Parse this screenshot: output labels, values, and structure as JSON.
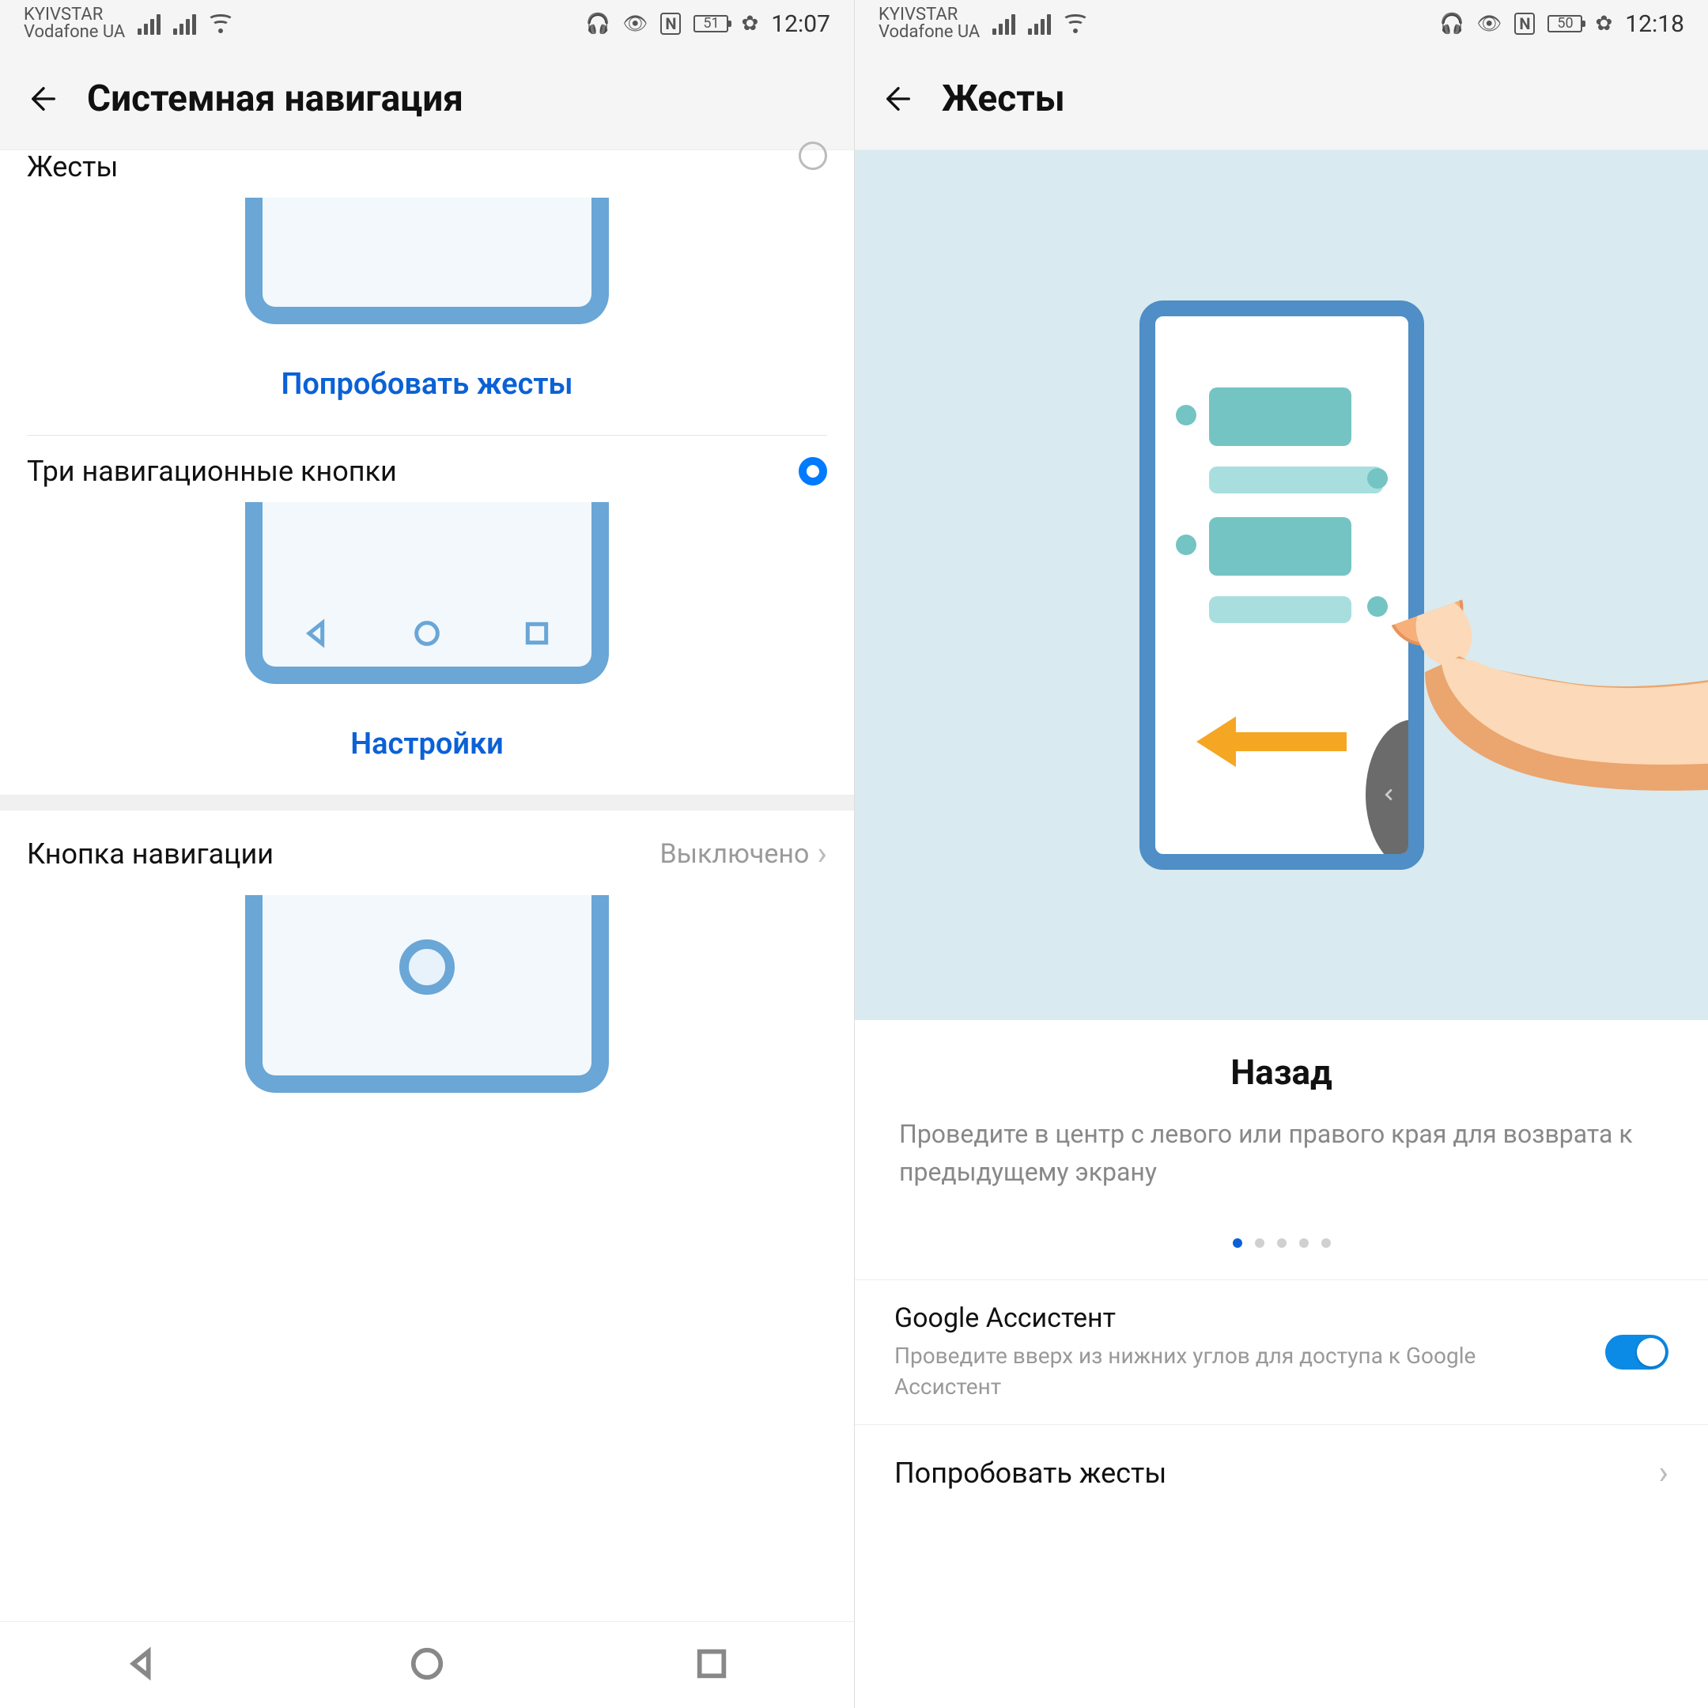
{
  "left": {
    "status": {
      "carrier1": "KYIVSTAR",
      "carrier2": "Vodafone UA",
      "battery": "51",
      "time": "12:07"
    },
    "title": "Системная навигация",
    "row_gestures": "Жесты",
    "btn_try_gestures": "Попробовать жесты",
    "row_three_keys": "Три навигационные кнопки",
    "btn_settings": "Настройки",
    "row_navbutton": "Кнопка навигации",
    "row_navbutton_value": "Выключено"
  },
  "right": {
    "status": {
      "carrier1": "KYIVSTAR",
      "carrier2": "Vodafone UA",
      "battery": "50",
      "time": "12:18"
    },
    "title": "Жесты",
    "tut_title": "Назад",
    "tut_desc": "Проведите в центр с левого или правого края для возврата к предыдущему экрану",
    "assistant_title": "Google Ассистент",
    "assistant_desc": "Проведите вверх из нижних углов для доступа к Google Ассистент",
    "try_gestures": "Попробовать жесты",
    "pager_total": 5,
    "pager_active": 1
  }
}
